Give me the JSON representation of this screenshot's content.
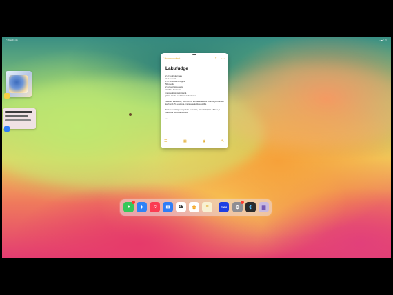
{
  "status_bar": {
    "left": "7.36  to 19.46",
    "right": ""
  },
  "note": {
    "back_label": "Huomautukset",
    "title": "Lakufudge",
    "lines": [
      "2 dl kuohukermaa",
      "2 dl sokeria",
      "1 dl tummaa siirappia",
      "50 g voita",
      "2 rkl lakritsijauhetta",
      "4 tabaa lenrsuota",
      "musteakirsimtekstäsitä",
      "jaloin tatuin suolakmia kakirakaja"
    ],
    "paragraph1": "Sekoita kattilassa, kuumenna keittäessänäitä kunnes jopuolleen kerhen 115 celsiusta, muista sekoittaa välillä.",
    "paragraph2": "Kaada lakritsijauhe pitkän uuhustin, sitoi jäähtyä. Leikkaa ja nauvista pikkupapaloiksi!",
    "extra": "...",
    "toolbar_icons": [
      "checklist-icon",
      "table-icon",
      "camera-icon",
      "pencil-compose-icon"
    ]
  },
  "dock": {
    "apps": [
      {
        "name": "messages-app",
        "label": "",
        "color": "#35c759",
        "badge": true
      },
      {
        "name": "safari-app",
        "label": "",
        "color": "#2f82f6",
        "badge": false
      },
      {
        "name": "music-app",
        "label": "♫",
        "color": "#fb3c52",
        "badge": false
      },
      {
        "name": "mail-app",
        "label": "✉",
        "color": "#2f7df6",
        "badge": false
      },
      {
        "name": "calendar-app",
        "label": "15",
        "color": "#ffffff",
        "badge": false
      },
      {
        "name": "photos-app",
        "label": "",
        "color": "#ffffff",
        "badge": false
      },
      {
        "name": "notes-app",
        "label": "",
        "color": "#f8f1d2",
        "badge": false
      },
      {
        "name": "max-app",
        "label": "max",
        "color": "#1d3fe3",
        "badge": false
      },
      {
        "name": "settings-app",
        "label": "⚙",
        "color": "#8e8e93",
        "badge": true
      },
      {
        "name": "davinci-app",
        "label": "",
        "color": "#2b2b2b",
        "badge": false
      },
      {
        "name": "app-library",
        "label": "",
        "color": "#c8b9e0",
        "badge": false
      }
    ]
  },
  "colors": {
    "accent": "#e0a41b"
  }
}
